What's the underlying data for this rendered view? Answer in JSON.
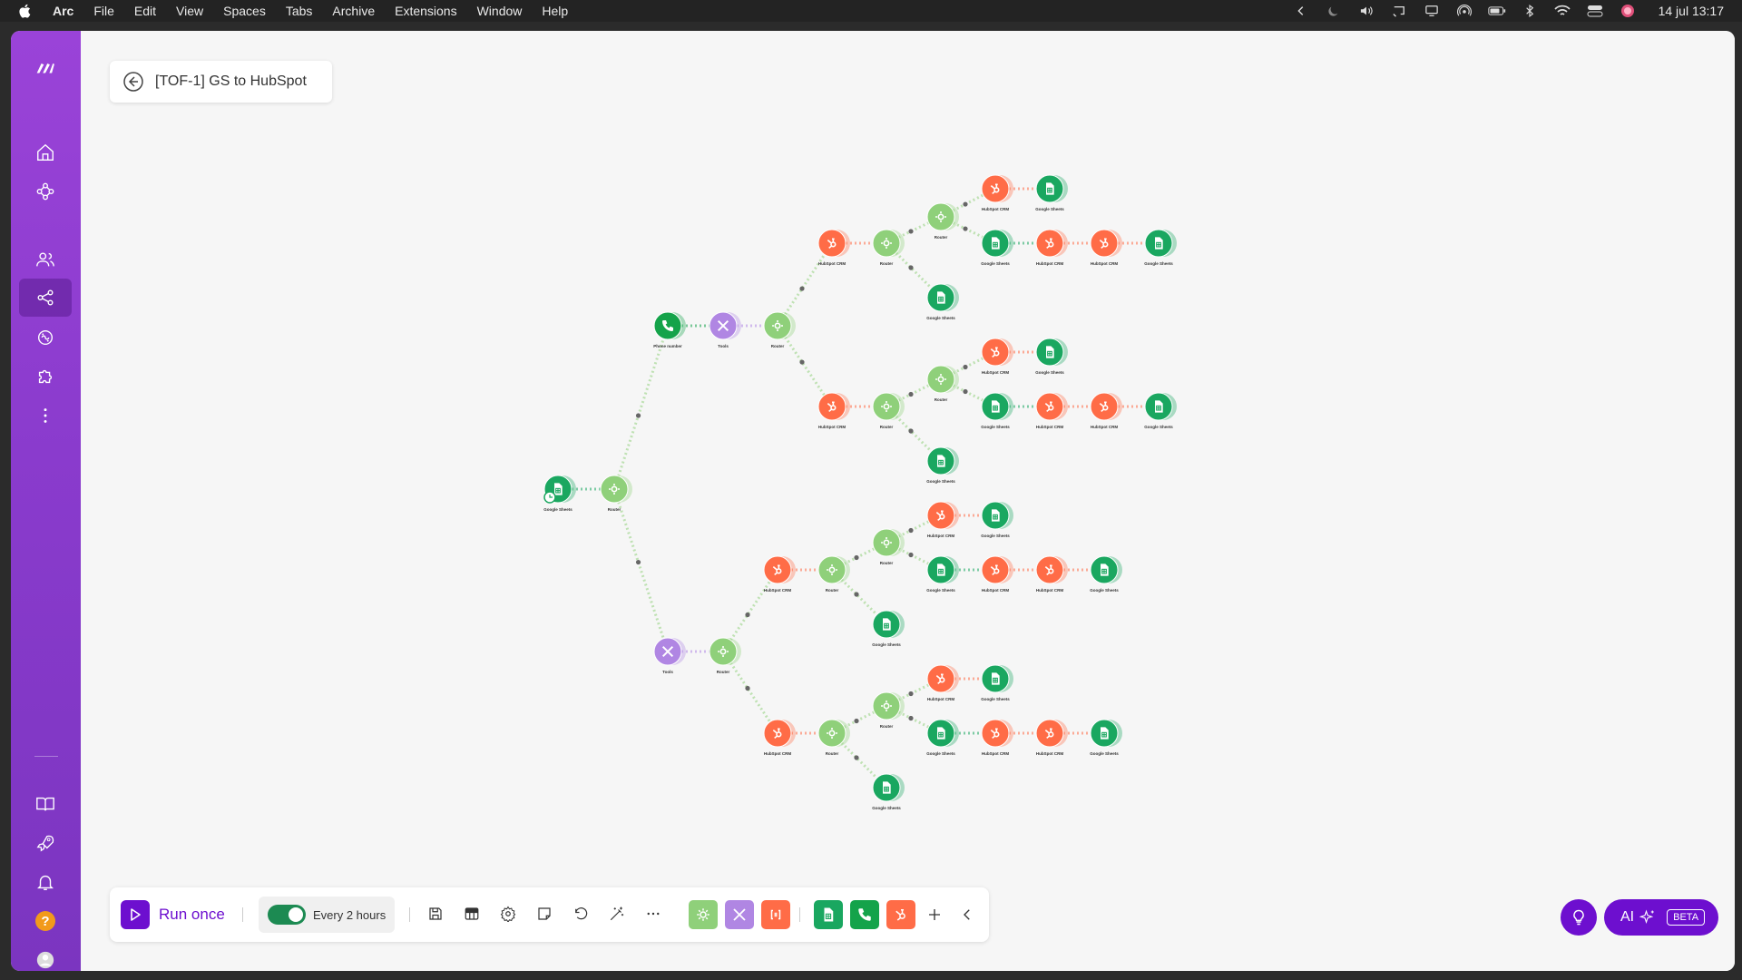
{
  "menubar": {
    "app": "Arc",
    "items": [
      "File",
      "Edit",
      "View",
      "Spaces",
      "Tabs",
      "Archive",
      "Extensions",
      "Window",
      "Help"
    ],
    "clock": "14 jul 13:17",
    "status_icons": [
      "chevron-left-icon",
      "moon-icon",
      "volume-icon",
      "cast-icon",
      "display-icon",
      "airdrop-icon",
      "battery-icon",
      "bluetooth-icon",
      "wifi-icon",
      "control-center-icon",
      "siri-icon"
    ]
  },
  "sidebar": {
    "logo": "make-logo",
    "items": [
      {
        "name": "home",
        "icon": "home-icon"
      },
      {
        "name": "templates",
        "icon": "nodes-icon"
      },
      {
        "name": "team",
        "icon": "users-icon"
      },
      {
        "name": "scenarios",
        "icon": "share-icon",
        "active": true
      },
      {
        "name": "connections",
        "icon": "link-icon"
      },
      {
        "name": "apps",
        "icon": "puzzle-icon"
      },
      {
        "name": "more",
        "icon": "more-vertical-icon"
      }
    ],
    "bottom_items": [
      {
        "name": "docs",
        "icon": "book-icon"
      },
      {
        "name": "whats-new",
        "icon": "rocket-icon"
      },
      {
        "name": "notifications",
        "icon": "bell-icon"
      },
      {
        "name": "help",
        "icon": "help-icon",
        "label": "?"
      },
      {
        "name": "profile",
        "icon": "avatar-icon"
      }
    ]
  },
  "scenario": {
    "title": "[TOF-1] GS to HubSpot"
  },
  "colors": {
    "router": "#8fd07a",
    "tools": "#b086e3",
    "hubspot": "#ff6c47",
    "sheets": "#1aa760",
    "phone": "#14a34a",
    "accent": "#6d0fcf"
  },
  "nodes": {
    "sheets_label": "Google Sheets",
    "router_label": "Router",
    "tools_label": "Tools",
    "hubspot_label": "HubSpot CRM",
    "phone_label": "Phone number"
  },
  "toolbar": {
    "run_label": "Run once",
    "schedule_label": "Every 2 hours",
    "schedule_on": true,
    "icons": [
      "save-icon",
      "blueprint-icon",
      "settings-icon",
      "notes-icon",
      "undo-icon",
      "magic-wand-icon",
      "more-icon"
    ],
    "modules": [
      "flow-control-icon",
      "tools-icon",
      "text-parser-icon",
      "sheets-icon",
      "phone-icon",
      "hubspot-icon",
      "plus-icon",
      "collapse-icon"
    ]
  },
  "ai": {
    "label": "AI",
    "badge": "BETA"
  }
}
